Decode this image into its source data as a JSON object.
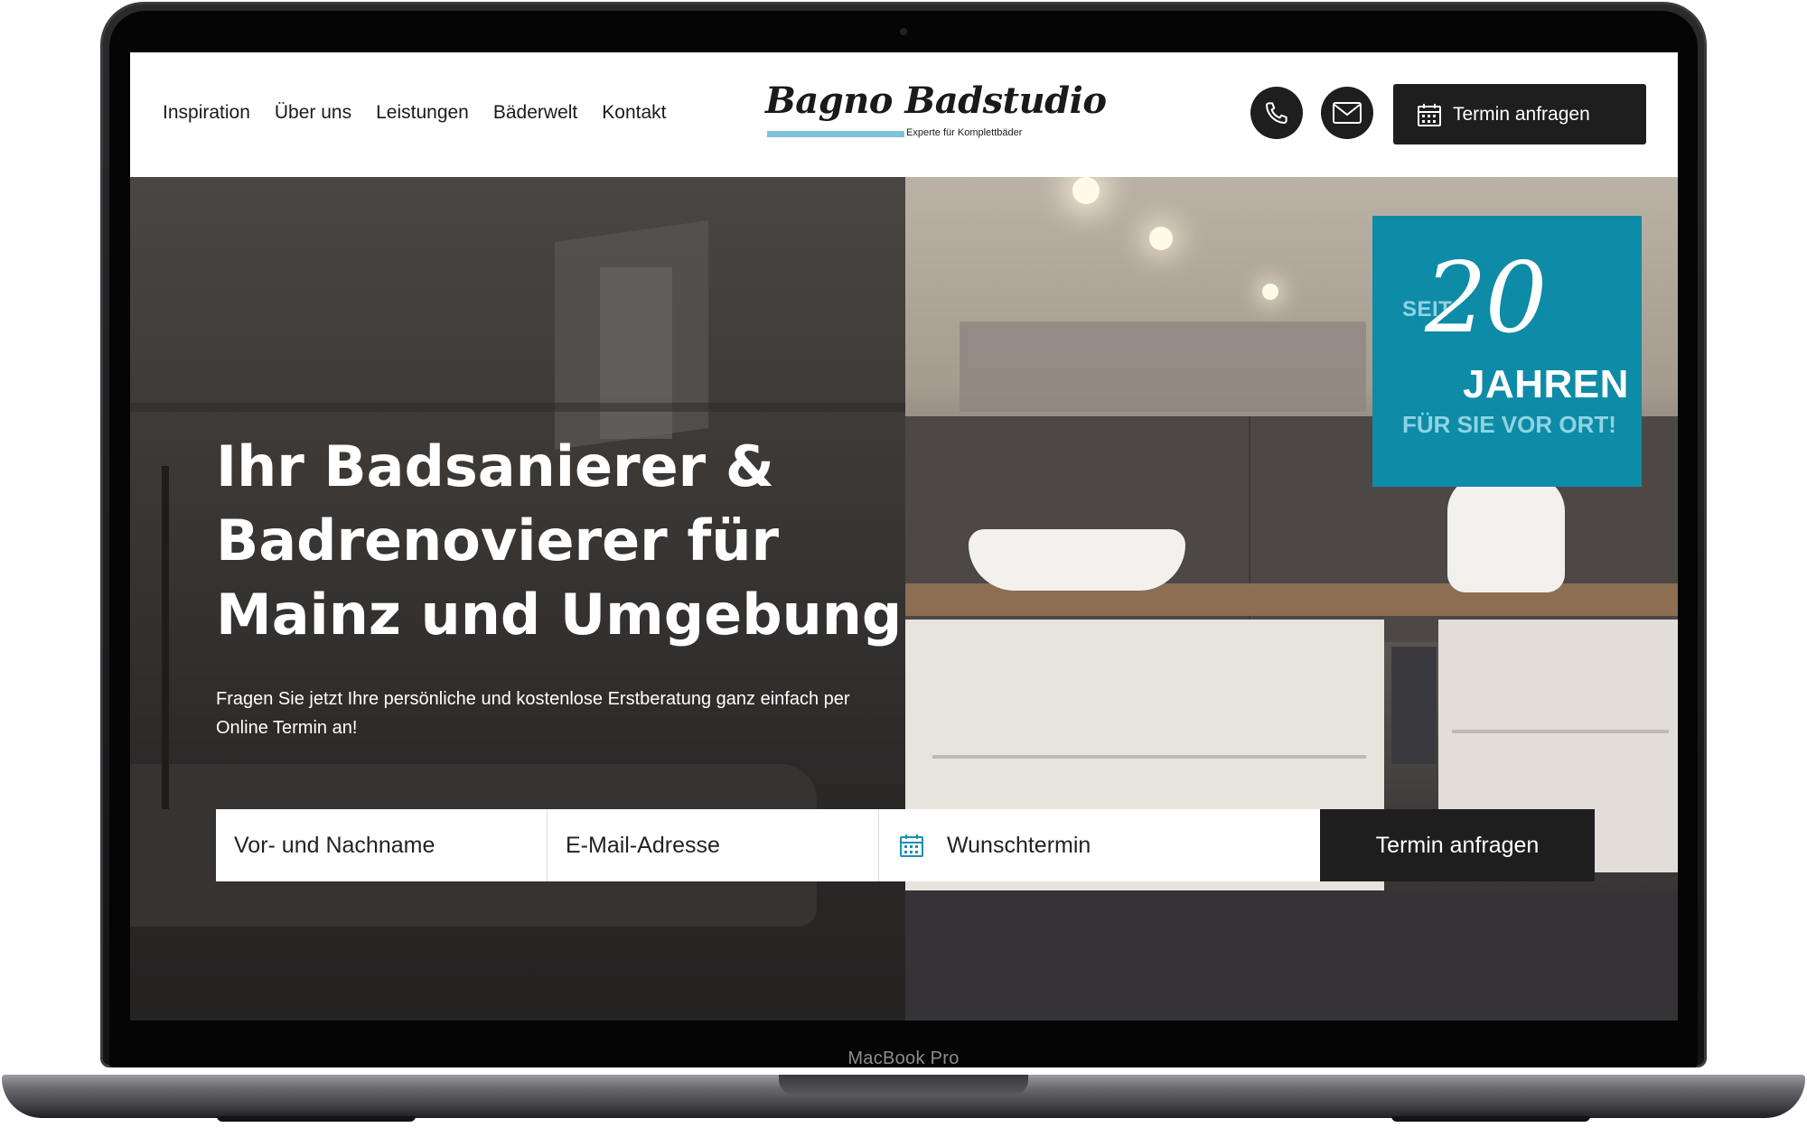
{
  "device": {
    "model_label": "MacBook Pro"
  },
  "header": {
    "nav": [
      {
        "label": "Inspiration"
      },
      {
        "label": "Über uns"
      },
      {
        "label": "Leistungen"
      },
      {
        "label": "Bäderwelt"
      },
      {
        "label": "Kontakt"
      }
    ],
    "logo": {
      "name": "Bagno Badstudio",
      "tagline": "Experte für Komplettbäder"
    },
    "icons": {
      "phone": "phone-icon",
      "mail": "mail-icon",
      "calendar": "calendar-icon"
    },
    "cta_label": "Termin anfragen"
  },
  "hero": {
    "headline": "Ihr Badsanierer & Badrenovierer für Mainz und Umgebung",
    "subtext": "Fragen Sie jetzt Ihre persönliche und kostenlose Erstberatung ganz einfach per Online Termin an!",
    "badge": {
      "prefix": "SEIT",
      "number": "20",
      "line1": "JAHREN",
      "line2": "FÜR SIE VOR ORT!"
    }
  },
  "form": {
    "name_placeholder": "Vor- und Nachname",
    "email_placeholder": "E-Mail-Adresse",
    "date_placeholder": "Wunschtermin",
    "submit_label": "Termin anfragen"
  },
  "colors": {
    "badge": "#0e8ba6",
    "badge_accent": "#8fd3e3",
    "dark_button": "#1e1e1e",
    "logo_bar": "#7ec3d6",
    "calendar_icon": "#1a8fb0"
  }
}
